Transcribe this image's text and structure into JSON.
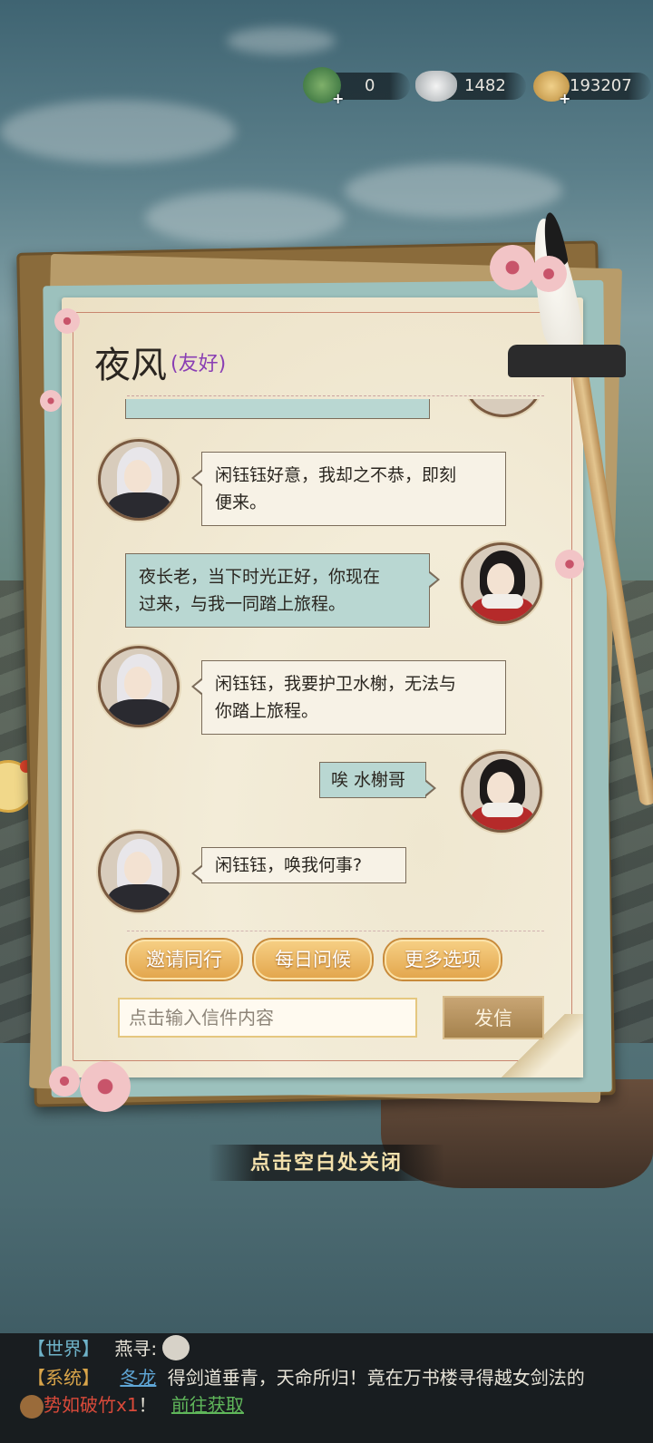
{
  "currencies": [
    {
      "icon": "jade-dragon-icon",
      "value": "0"
    },
    {
      "icon": "silver-ingot-icon",
      "value": "1482"
    },
    {
      "icon": "copper-coin-icon",
      "value": "193207"
    }
  ],
  "letter": {
    "contact_name": "夜风",
    "relation": "(友好)",
    "messages": [
      {
        "side": "left",
        "speaker": "npc",
        "text_lines": [
          "闲钰钰好意，我却之不恭，即刻",
          "便来。"
        ]
      },
      {
        "side": "right",
        "speaker": "player",
        "text_lines": [
          "夜长老，当下时光正好，你现在",
          "过来，与我一同踏上旅程。"
        ]
      },
      {
        "side": "left",
        "speaker": "npc",
        "text_lines": [
          "闲钰钰，我要护卫水榭，无法与",
          "你踏上旅程。"
        ]
      },
      {
        "side": "right",
        "speaker": "player",
        "text_lines": [
          "唉 水榭哥"
        ]
      },
      {
        "side": "left",
        "speaker": "npc",
        "text_lines": [
          "闲钰钰，唤我何事?"
        ]
      }
    ],
    "options": [
      "邀请同行",
      "每日问候",
      "更多选项"
    ],
    "input_placeholder": "点击输入信件内容",
    "send_label": "发信"
  },
  "close_hint": "点击空白处关闭",
  "chat_log": {
    "line1": {
      "channel": "【世界】",
      "speaker": "燕寻:"
    },
    "line2": {
      "channel": "【系统】",
      "player": "冬龙",
      "text": "得剑道垂青，天命所归！竟在万书楼寻得越女剑法的"
    },
    "line3": {
      "item": "势如破竹x1",
      "suffix": "！",
      "link": "前往获取"
    }
  },
  "colors": {
    "relation": "#8a3fb4",
    "player_bubble": "#b9d7d2",
    "npc_bubble": "#f7f2e6",
    "option_button": "#e3a74e"
  }
}
